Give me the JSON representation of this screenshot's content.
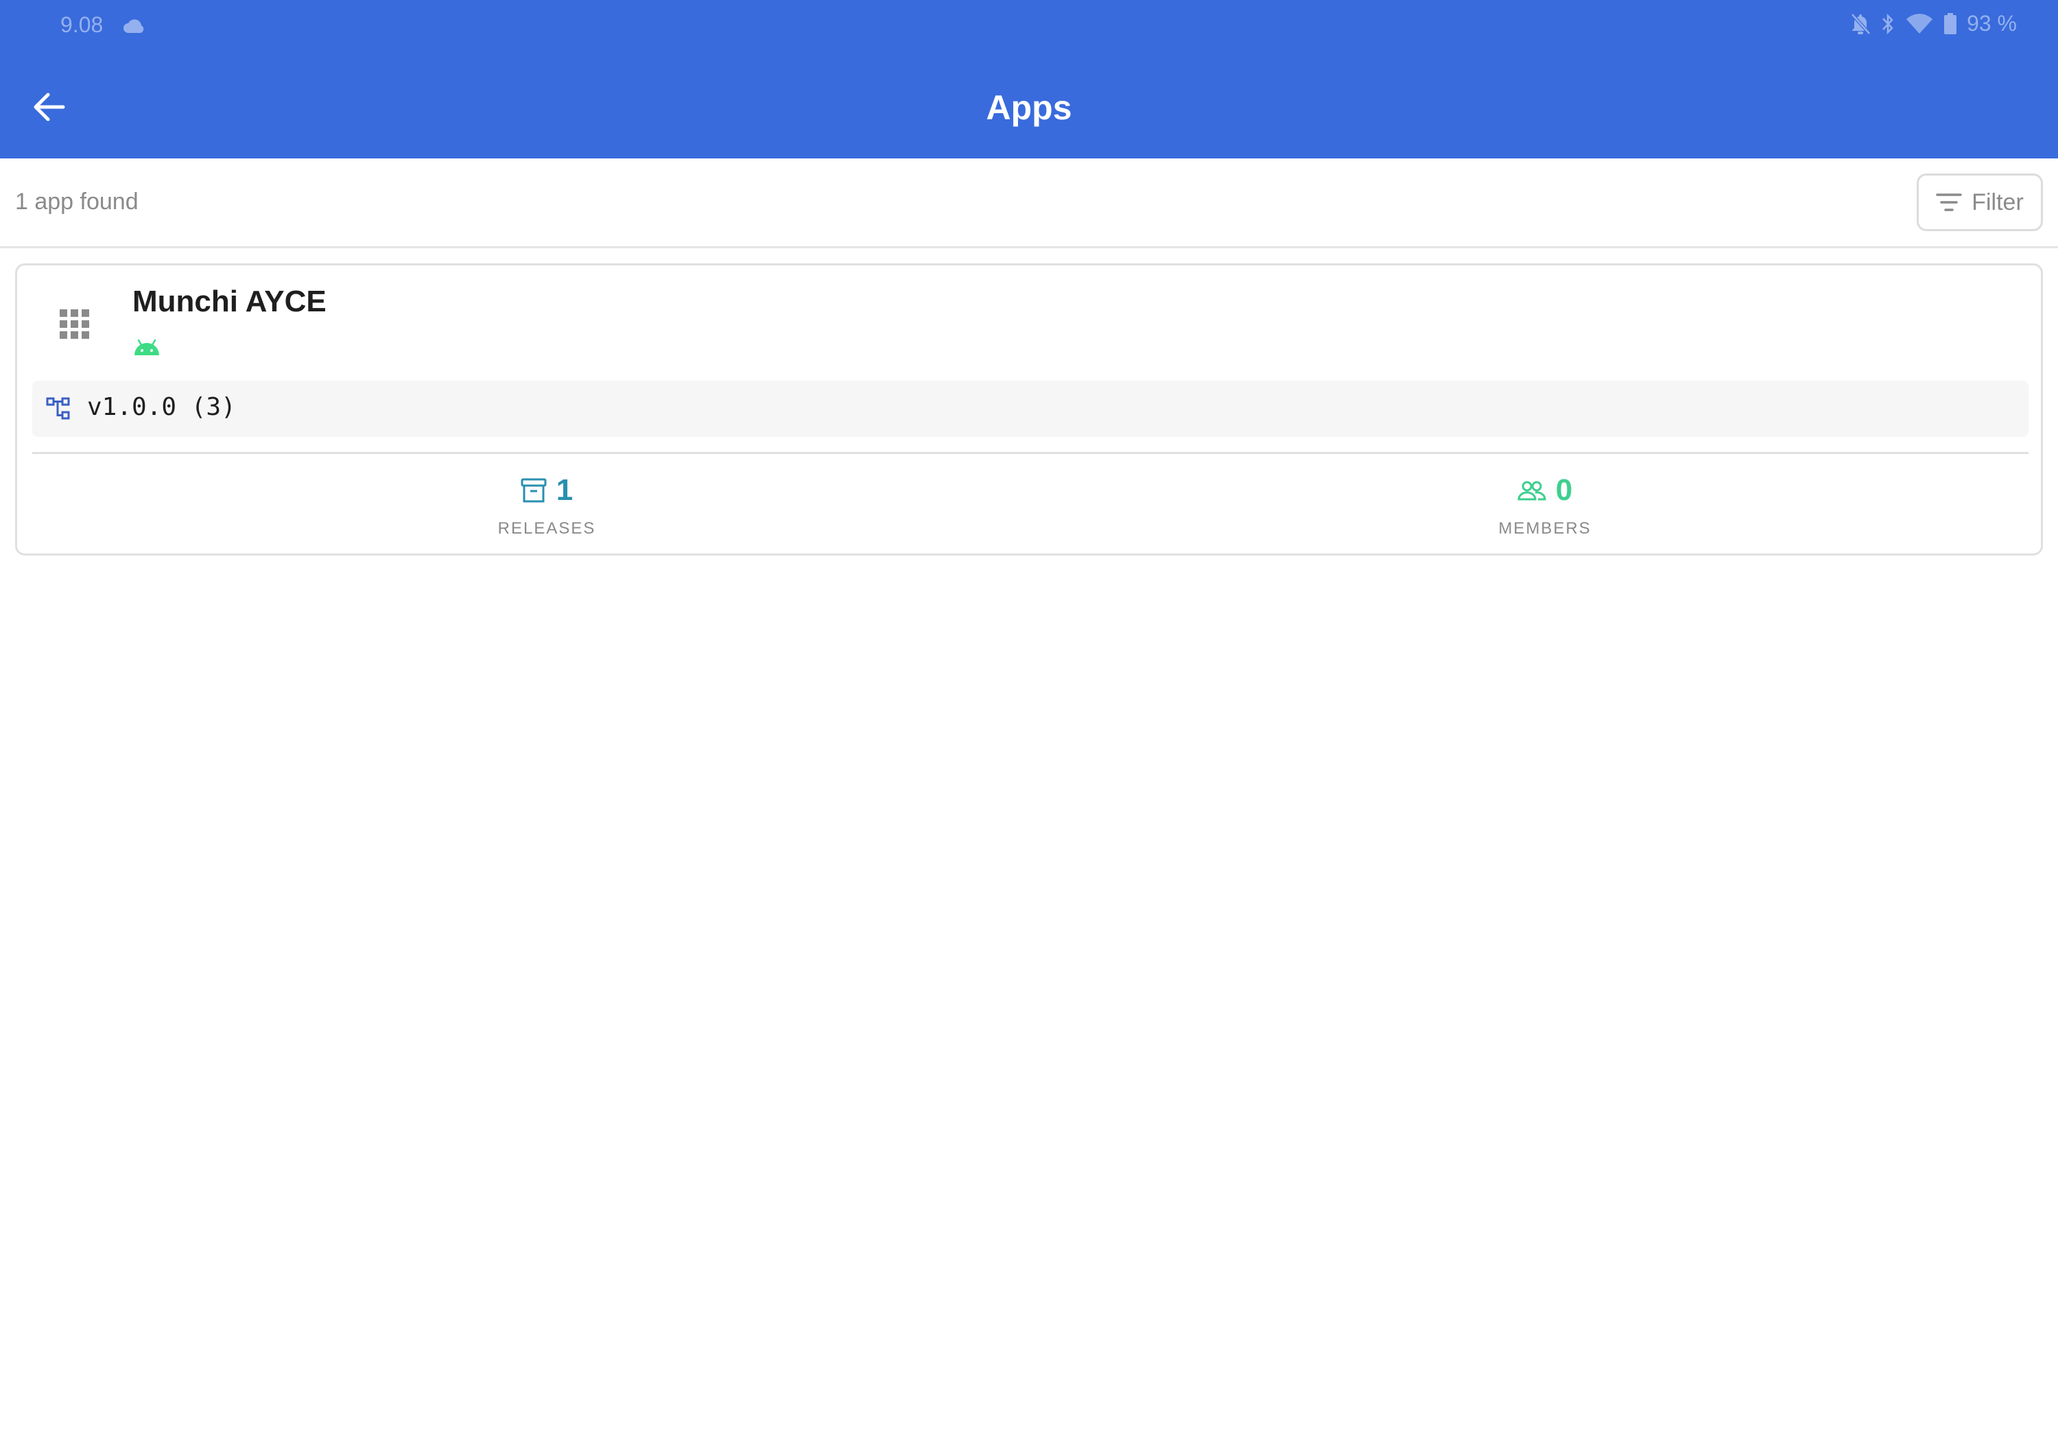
{
  "status_bar": {
    "time": "9.08",
    "battery": "93 %"
  },
  "app_bar": {
    "title": "Apps"
  },
  "results": {
    "count_text": "1 app found",
    "filter_label": "Filter"
  },
  "apps": [
    {
      "name": "Munchi AYCE",
      "platform_icon": "android-icon",
      "version": "v1.0.0 (3)",
      "releases_value": "1",
      "releases_label": "RELEASES",
      "members_value": "0",
      "members_label": "MEMBERS"
    }
  ],
  "colors": {
    "app_bar": "#396bdc",
    "releases_accent": "#2a8fb0",
    "members_accent": "#3ecf8e",
    "android_green": "#3ddc84",
    "version_icon": "#3a5fc4"
  }
}
